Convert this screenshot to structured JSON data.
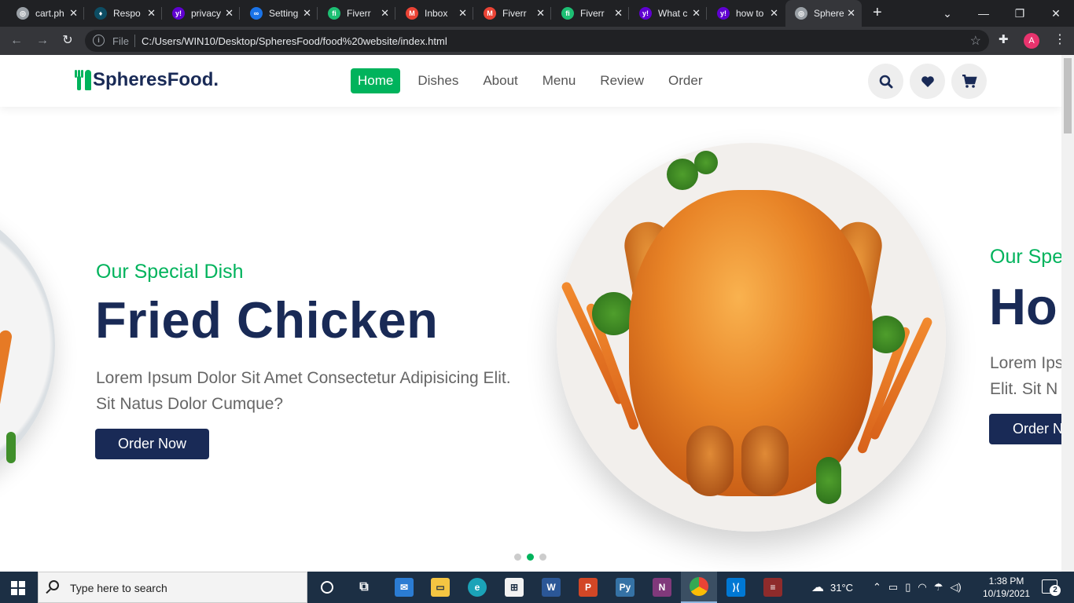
{
  "browser": {
    "tabs": [
      {
        "title": "cart.ph",
        "fav_color": "#9aa0a6",
        "fav_glyph": "◎"
      },
      {
        "title": "Respo",
        "fav_color": "#0d4d63",
        "fav_glyph": "♦"
      },
      {
        "title": "privacy",
        "fav_color": "#5f01d1",
        "fav_glyph": "y!"
      },
      {
        "title": "Setting",
        "fav_color": "#1a73e8",
        "fav_glyph": "∞"
      },
      {
        "title": "Fiverr",
        "fav_color": "#1dbf73",
        "fav_glyph": "fi"
      },
      {
        "title": "Inbox",
        "fav_color": "#ea4335",
        "fav_glyph": "M"
      },
      {
        "title": "Fiverr",
        "fav_color": "#ea4335",
        "fav_glyph": "M"
      },
      {
        "title": "Fiverr",
        "fav_color": "#1dbf73",
        "fav_glyph": "fi"
      },
      {
        "title": "What c",
        "fav_color": "#5f01d1",
        "fav_glyph": "y!"
      },
      {
        "title": "how to",
        "fav_color": "#5f01d1",
        "fav_glyph": "y!"
      },
      {
        "title": "Sphere",
        "fav_color": "#9aa0a6",
        "fav_glyph": "◎",
        "active": true
      }
    ],
    "new_tab": "+",
    "window_controls": {
      "dropdown": "⌄",
      "minimize": "—",
      "restore": "❐",
      "close": "✕"
    },
    "address": {
      "file_label": "File",
      "url": "C:/Users/WIN10/Desktop/SpheresFood/food%20website/index.html"
    },
    "profile_initial": "A"
  },
  "site": {
    "logo_text": "SpheresFood.",
    "nav": [
      "Home",
      "Dishes",
      "About",
      "Menu",
      "Review",
      "Order"
    ],
    "active_nav": "Home",
    "accent_color": "#00b35c",
    "primary_color": "#192a56"
  },
  "hero": {
    "subtitle": "Our Special Dish",
    "title": "Fried Chicken",
    "description": "Lorem Ipsum Dolor Sit Amet Consectetur Adipisicing Elit. Sit Natus Dolor Cumque?",
    "button": "Order Now",
    "next_slide": {
      "subtitle": "Our Spe",
      "title": "Ho",
      "description_line1": "Lorem Ips",
      "description_line2": "Elit. Sit N",
      "button": "Order N"
    },
    "slide_count": 3,
    "active_slide": 2
  },
  "taskbar": {
    "search_placeholder": "Type here to search",
    "weather": "31°C",
    "time": "1:38 PM",
    "date": "10/19/2021",
    "notification_count": "2"
  }
}
